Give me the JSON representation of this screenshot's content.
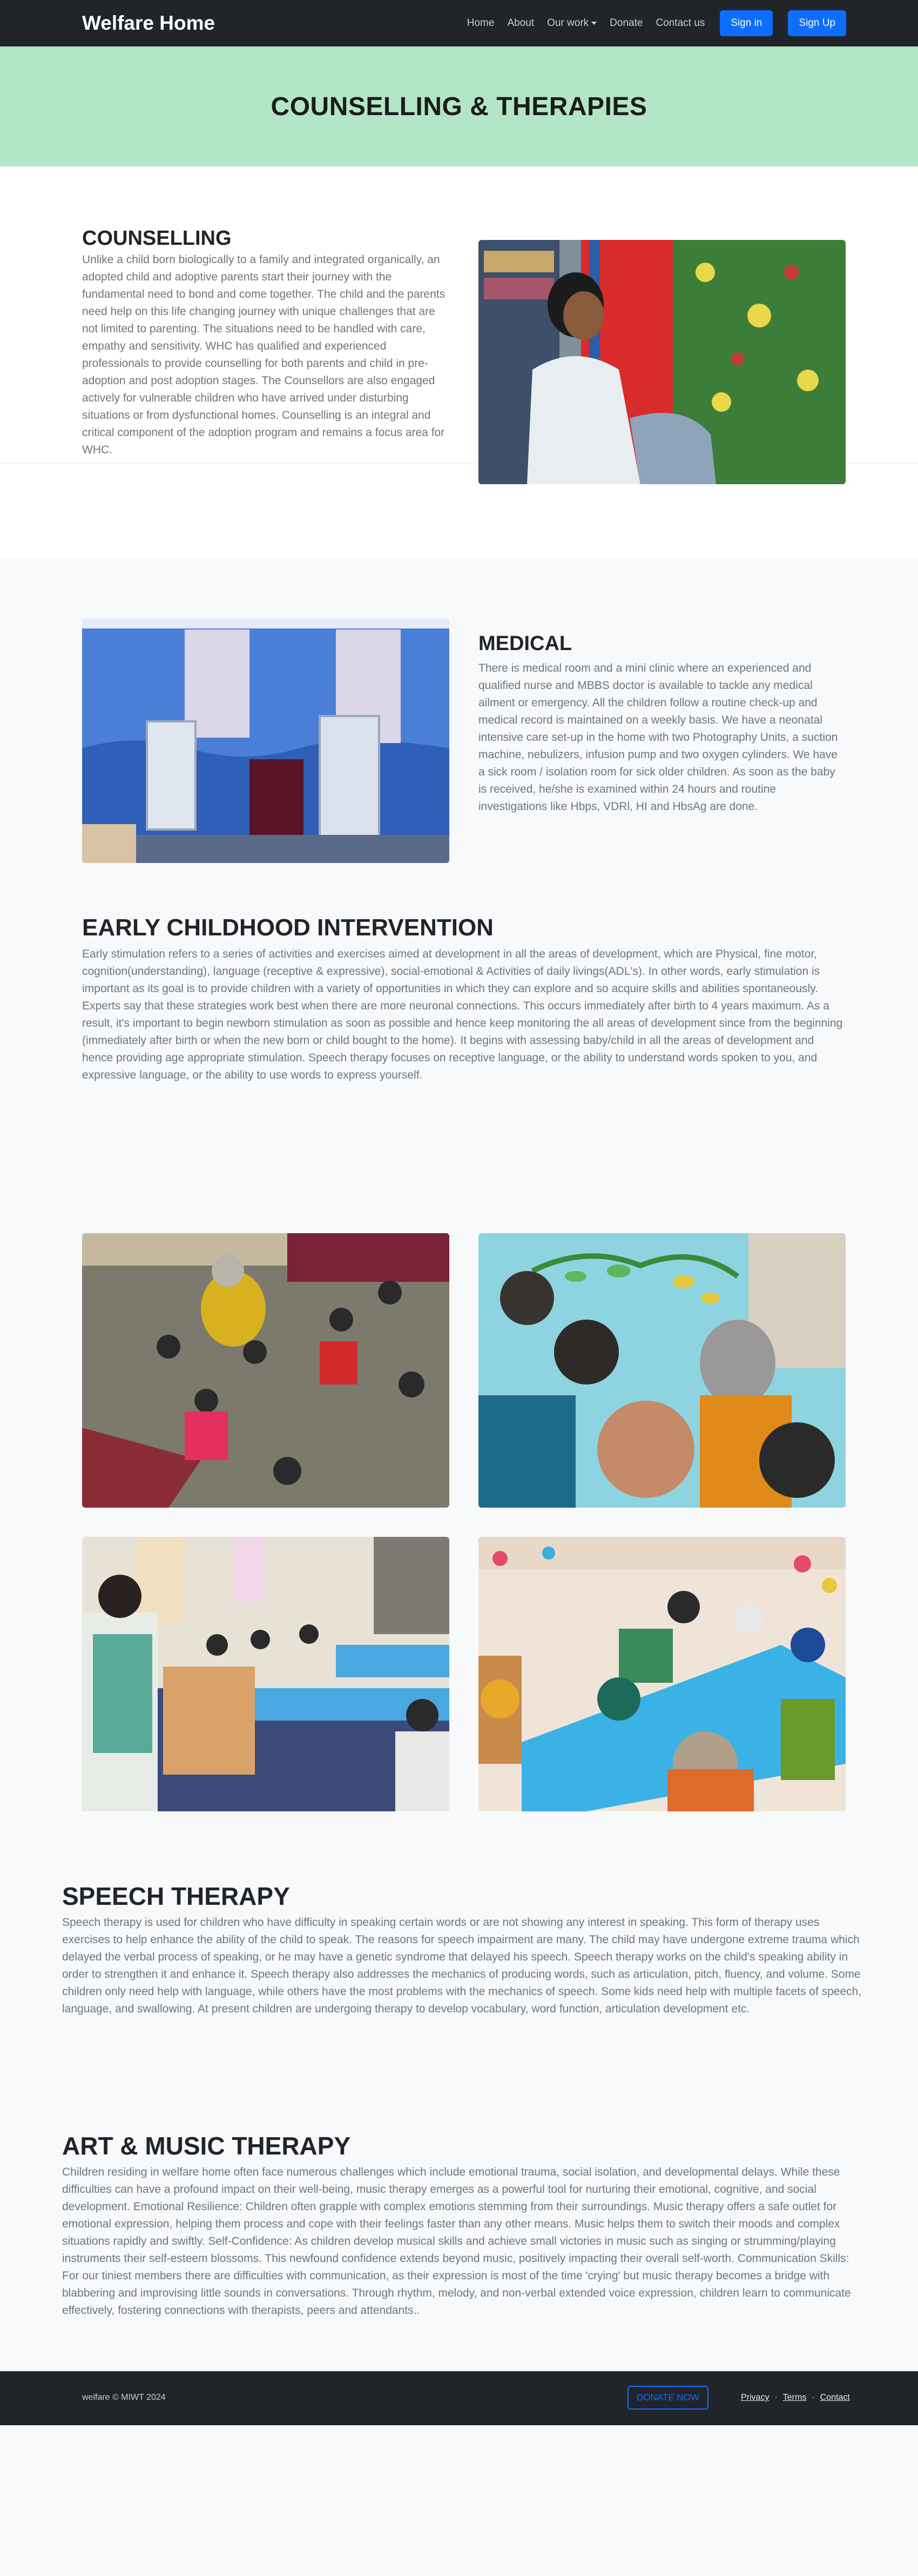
{
  "navbar": {
    "brand": "Welfare Home",
    "links": [
      "Home",
      "About",
      "Our work",
      "Donate",
      "Contact us"
    ],
    "signin": "Sign in",
    "signup": "Sign Up"
  },
  "hero": {
    "title": "COUNSELLING & THERAPIES"
  },
  "counselling": {
    "title": "COUNSELLING",
    "text": "Unlike a child born biologically to a family and integrated organically, an adopted child and adoptive parents start their journey with the fundamental need to bond and come together. The child and the parents need help on this life changing journey with unique challenges that are not limited to parenting. The situations need to be handled with care, empathy and sensitivity. WHC has qualified and experienced professionals to provide counselling for both parents and child in pre-adoption and post adoption stages. The Counsellors are also engaged actively for vulnerable children who have arrived under disturbing situations or from dysfunctional homes. Counselling is an integral and critical component of the adoption program and remains a focus area for WHC."
  },
  "medical": {
    "title": "MEDICAL",
    "text": "There is medical room and a mini clinic where an experienced and qualified nurse and MBBS doctor is available to tackle any medical ailment or emergency. All the children follow a routine check-up and medical record is maintained on a weekly basis. We have a neonatal intensive care set-up in the home with two Photography Units, a suction machine, nebulizers, infusion pump and two oxygen cylinders. We have a sick room / isolation room for sick older children. As soon as the baby is received, he/she is examined within 24 hours and routine investigations like Hbps, VDRl, HI and HbsAg are done."
  },
  "eci": {
    "title": "EARLY CHILDHOOD INTERVENTION",
    "text": "Early stimulation refers to a series of activities and exercises aimed at development in all the areas of development, which are Physical, fine motor, cognition(understanding), language (receptive & expressive), social-emotional & Activities of daily livings(ADL's). In other words, early stimulation is important as its goal is to provide children with a variety of opportunities in which they can explore and so acquire skills and abilities spontaneously. Experts say that these strategies work best when there are more neuronal connections. This occurs immediately after birth to 4 years maximum. As a result, it's important to begin newborn stimulation as soon as possible and hence keep monitoring the all areas of development since from the beginning (immediately after birth or when the new born or child bought to the home). It begins with assessing baby/child in all the areas of development and hence providing age appropriate stimulation. Speech therapy focuses on receptive language, or the ability to understand words spoken to you, and expressive language, or the ability to use words to express yourself."
  },
  "speech": {
    "title": "SPEECH THERAPY",
    "text": "Speech therapy is used for children who have difficulty in speaking certain words or are not showing any interest in speaking. This form of therapy uses exercises to help enhance the ability of the child to speak. The reasons for speech impairment are many. The child may have undergone extreme trauma which delayed the verbal process of speaking, or he may have a genetic syndrome that delayed his speech. Speech therapy works on the child's speaking ability in order to strengthen it and enhance it. Speech therapy also addresses the mechanics of producing words, such as articulation, pitch, fluency, and volume. Some children only need help with language, while others have the most problems with the mechanics of speech. Some kids need help with multiple facets of speech, language, and swallowing. At present children are undergoing therapy to develop vocabulary, word function, articulation development etc."
  },
  "art": {
    "title": "ART & MUSIC THERAPY",
    "text": "Children residing in welfare home often face numerous challenges which include emotional trauma, social isolation, and developmental delays. While these difficulties can have a profound impact on their well-being, music therapy emerges as a powerful tool for nurturing their emotional, cognitive, and social development. Emotional Resilience: Children often grapple with complex emotions stemming from their surroundings. Music therapy offers a safe outlet for emotional expression, helping them process and cope with their feelings faster than any other means. Music helps them to switch their moods and complex situations rapidly and swiftly. Self-Confidence: As children develop musical skills and achieve small victories in music such as singing or strumming/playing instruments their self-esteem blossoms. This newfound confidence extends beyond music, positively impacting their overall self-worth. Communication Skills: For our tiniest members there are difficulties with communication, as their expression is most of the time 'crying' but music therapy becomes a bridge with blabbering and improvising little sounds in conversations. Through rhythm, melody, and non-verbal extended voice expression, children learn to communicate effectively, fostering connections with therapists, peers and attendants.."
  },
  "footer": {
    "copyright": "welfare © MIWT 2024",
    "donate": "DONATE NOW",
    "links": [
      "Privacy",
      "Terms",
      "Contact"
    ]
  },
  "colors": {
    "navbar": "#212529",
    "hero": "#b3e6c6",
    "primary": "#0d6efd",
    "text_muted": "#6c757d"
  }
}
